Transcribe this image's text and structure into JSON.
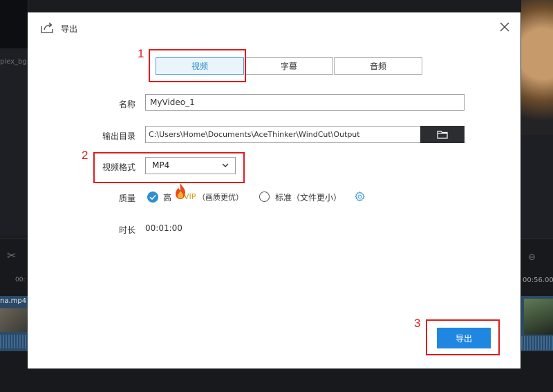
{
  "background": {
    "left_file_name": "plex_bg...",
    "timestamp_left": "00:",
    "timestamp_right": "00:56.00",
    "clip_name": "na.mp4"
  },
  "dialog": {
    "title": "导出",
    "tabs": [
      {
        "label": "视频",
        "active": true
      },
      {
        "label": "字幕",
        "active": false
      },
      {
        "label": "音频",
        "active": false
      }
    ],
    "name_label": "名称",
    "name_value": "MyVideo_1",
    "output_dir_label": "输出目录",
    "output_dir_value": "C:\\Users\\Home\\Documents\\AceThinker\\WindCut\\Output",
    "format_label": "视频格式",
    "format_value": "MP4",
    "quality_label": "质量",
    "quality_high": "高",
    "quality_vip": "VIP",
    "quality_vip_note": "（画质更优）",
    "quality_standard": "标准（文件更小）",
    "quality_selected": "high",
    "duration_label": "时长",
    "duration_value": "00:01:00",
    "export_button": "导出"
  },
  "annotations": [
    "1",
    "2",
    "3"
  ],
  "colors": {
    "accent": "#1f87e0",
    "annotation": "#e01b1b",
    "vip": "#d29a0a",
    "tab_active_text": "#2f8ed2"
  }
}
